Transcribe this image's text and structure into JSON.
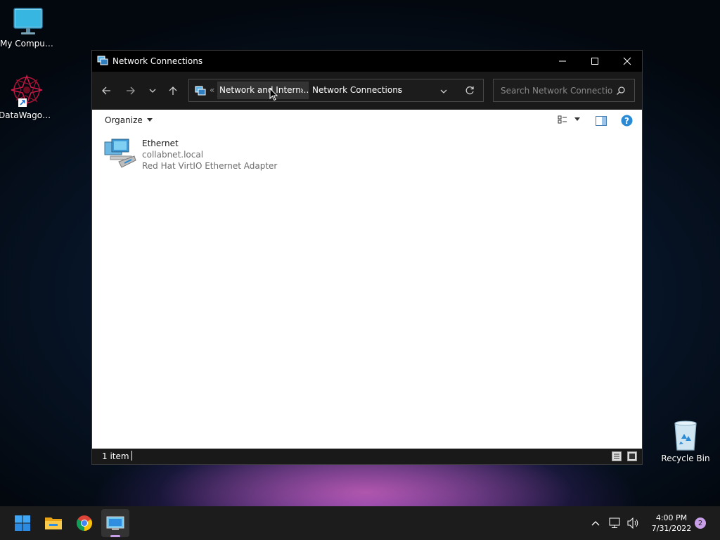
{
  "desktop": {
    "icons": [
      {
        "label": "My Computer",
        "icon": "monitor-icon"
      },
      {
        "label": "DataWagon...",
        "icon": "datawagon-icon"
      },
      {
        "label": "Recycle Bin",
        "icon": "recycle-bin-icon"
      }
    ]
  },
  "window": {
    "title": "Network Connections",
    "controls": {
      "minimize": "minimize-icon",
      "maximize": "maximize-icon",
      "close": "close-icon"
    },
    "nav": {
      "breadcrumb_prefix": "«",
      "breadcrumbs": [
        "Network and Intern...",
        "Network Connections"
      ],
      "search_placeholder": "Search Network Connections"
    },
    "command_bar": {
      "organize_label": "Organize"
    },
    "items": [
      {
        "name": "Ethernet",
        "network": "collabnet.local",
        "device": "Red Hat VirtIO Ethernet Adapter",
        "icon": "network-adapter-icon"
      }
    ],
    "status": {
      "item_count": "1 item"
    }
  },
  "taskbar": {
    "pinned": [
      "windows-start-icon",
      "file-explorer-icon",
      "chrome-icon",
      "network-connections-icon"
    ],
    "clock": {
      "time": "4:00 PM",
      "date": "7/31/2022"
    },
    "notification_count": "2"
  },
  "colors": {
    "accent": "#0078d4",
    "help": "#2a8ad4",
    "window_dark": "#202020",
    "titlebar": "#000000",
    "taskbar": "#1c1c1c",
    "notification_badge": "#c9a0e8"
  }
}
